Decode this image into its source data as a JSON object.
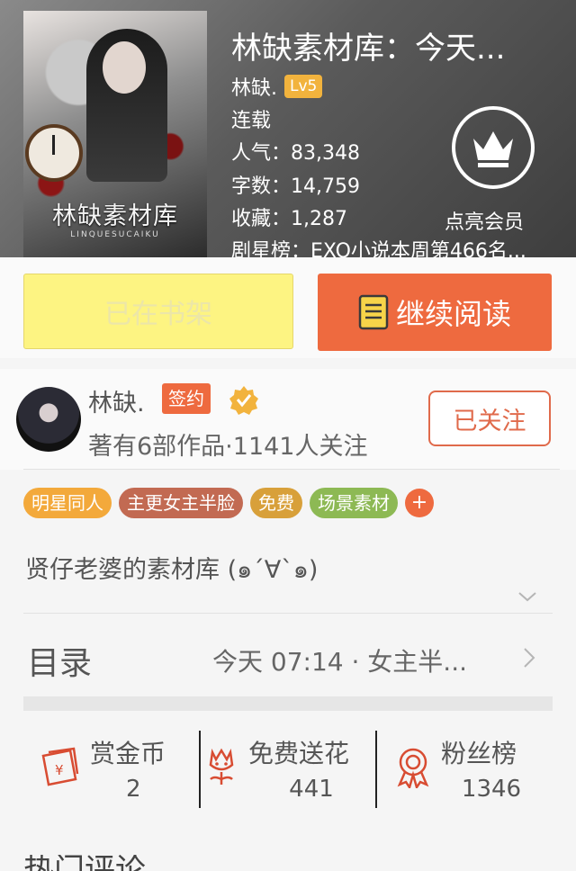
{
  "book": {
    "title": "林缺素材库：今天...",
    "cover_title": "林缺素材库",
    "cover_subtitle": "LINQUESUCAIKU",
    "author": "林缺.",
    "level": "Lv5",
    "status": "连载",
    "popularity": "人气：83,348",
    "word_count": "字数：14,759",
    "favorites": "收藏：1,287",
    "ranking": "剧星榜：EXO小说本周第466名..."
  },
  "vip": {
    "label": "点亮会员",
    "icon": "crown-icon"
  },
  "actions": {
    "shelf_label": "已在书架",
    "read_label": "继续阅读",
    "colors": {
      "shelf": "#fdf482",
      "read": "#ee6a3f"
    }
  },
  "author_card": {
    "name": "林缺.",
    "signed_label": "签约",
    "works": "著有6部作品·1141人关注",
    "follow_label": "已关注"
  },
  "tags": [
    {
      "label": "明星同人",
      "color": "#f3a93b"
    },
    {
      "label": "主更女主半脸",
      "color": "#c26a52"
    },
    {
      "label": "免费",
      "color": "#d8a03a"
    },
    {
      "label": "场景素材",
      "color": "#8db954"
    }
  ],
  "tag_plus": "+",
  "description": "贤仔老婆的素材库 (๑´∀`๑)",
  "catalog": {
    "label": "目录",
    "latest": "今天 07:14 · 女主半..."
  },
  "stats": [
    {
      "label": "赏金币",
      "value": "2",
      "icon": "red-envelope-icon"
    },
    {
      "label": "免费送花",
      "value": "441",
      "icon": "flower-icon"
    },
    {
      "label": "粉丝榜",
      "value": "1346",
      "icon": "award-ribbon-icon"
    }
  ],
  "bottom_peek": "热门评论"
}
